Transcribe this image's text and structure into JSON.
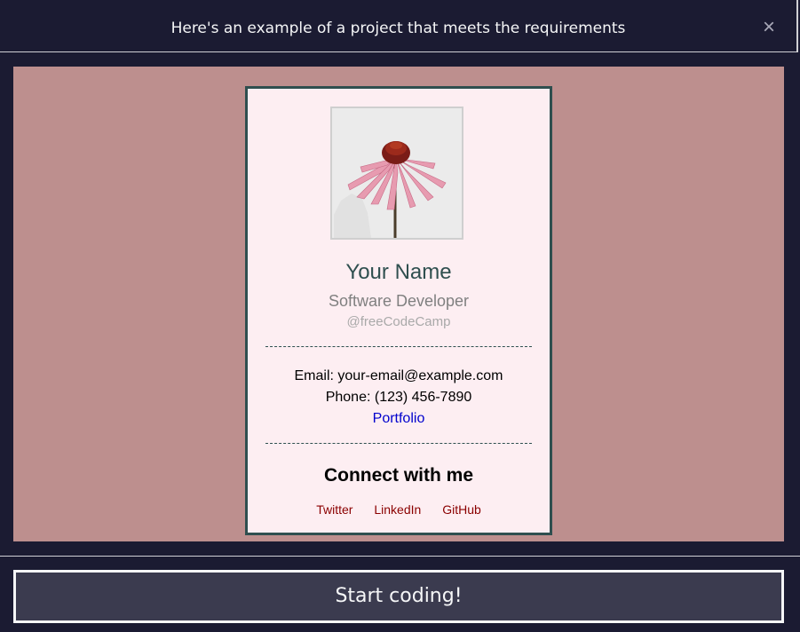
{
  "modal": {
    "title": "Here's an example of a project that meets the requirements",
    "close_label": "×"
  },
  "card": {
    "name": "Your Name",
    "role": "Software Developer",
    "handle": "@freeCodeCamp",
    "email": "Email: your-email@example.com",
    "phone": "Phone: (123) 456-7890",
    "portfolio": "Portfolio",
    "connect_heading": "Connect with me",
    "socials": [
      "Twitter",
      "LinkedIn",
      "GitHub"
    ],
    "photo_icon": "echinacea-flower-icon"
  },
  "footer": {
    "start_label": "Start coding!"
  },
  "colors": {
    "modal_bg": "#1b1b32",
    "preview_bg": "#bd8f8e",
    "card_bg": "#fdeef2",
    "card_border": "#2f4f4f",
    "link_blue": "#0000cd",
    "social_red": "#8b0000",
    "button_bg": "#3b3b4f"
  }
}
